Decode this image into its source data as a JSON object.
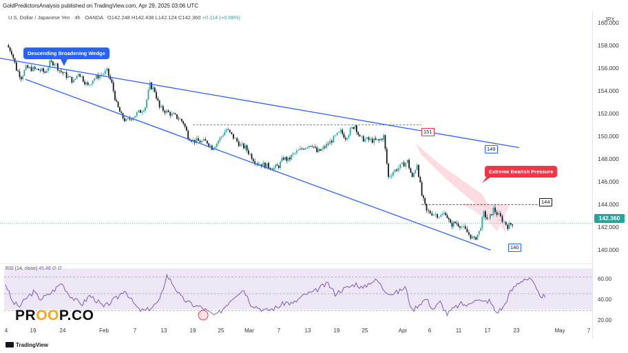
{
  "header": {
    "publish_line": "GoldPredictorsAnalysis published on TradingView.com, Apr 29, 2025 03:06 UTC",
    "symbol": "U.S. Dollar / Japanese Yen",
    "interval": "4h",
    "source": "OANDA",
    "ohlc": {
      "open": "O142.248",
      "high": "H142.438",
      "low": "L142.124",
      "close": "C142.360",
      "change": "+0.114 (+0.08%)"
    }
  },
  "colors": {
    "up": "#26a69a",
    "down": "#131722",
    "wedge_line": "#2962ff",
    "resistance_dash": "#f23645",
    "rsi_line": "#7e57c2",
    "rsi_band": "#ede7f6",
    "arrow_fill": "#fbd5dc"
  },
  "currency_label": "JPY",
  "last_price": "142.360",
  "annotations": {
    "wedge_label": "Descending Broadening Wedge",
    "pressure_label": "Extreme Bearish Pressure",
    "level_151": "151",
    "level_149": "149",
    "level_144": "144",
    "level_140": "140"
  },
  "rsi": {
    "label": "RSI (14, close)",
    "value": "45.48",
    "extra": "∅ ∅",
    "ticks": [
      "60.00",
      "40.00",
      "20.00"
    ]
  },
  "watermark": {
    "left": "PR",
    "middle": "OO",
    "right": "P.CO"
  },
  "footer": "TradingView",
  "chart_data": {
    "type": "candlestick",
    "title": "",
    "xlabel": "",
    "ylabel": "",
    "ylim": [
      139,
      161
    ],
    "y_ticks": [
      "160.000",
      "158.000",
      "156.000",
      "154.000",
      "152.000",
      "150.000",
      "148.000",
      "146.000",
      "144.000",
      "142.000",
      "140.000"
    ],
    "x_ticks": [
      "4",
      "19",
      "24",
      "Feb",
      "7",
      "13",
      "19",
      "25",
      "Mar",
      "7",
      "13",
      "19",
      "25",
      "Apr",
      "6",
      "11",
      "17",
      "23",
      "May",
      "7"
    ],
    "close_path": [
      [
        "Jan 13",
        158.0
      ],
      [
        "Jan 14",
        157.4
      ],
      [
        "Jan 15",
        155.9
      ],
      [
        "Jan 16",
        155.2
      ],
      [
        "Jan 17",
        156.0
      ],
      [
        "Jan 20",
        155.8
      ],
      [
        "Jan 21",
        155.6
      ],
      [
        "Jan 22",
        156.4
      ],
      [
        "Jan 23",
        156.5
      ],
      [
        "Jan 24",
        155.8
      ],
      [
        "Jan 27",
        154.8
      ],
      [
        "Jan 28",
        155.6
      ],
      [
        "Jan 29",
        155.0
      ],
      [
        "Jan 30",
        154.4
      ],
      [
        "Jan 31",
        155.0
      ],
      [
        "Feb 3",
        155.7
      ],
      [
        "Feb 4",
        154.6
      ],
      [
        "Feb 5",
        152.8
      ],
      [
        "Feb 6",
        151.8
      ],
      [
        "Feb 7",
        151.3
      ],
      [
        "Feb 10",
        152.2
      ],
      [
        "Feb 11",
        152.6
      ],
      [
        "Feb 12",
        154.5
      ],
      [
        "Feb 13",
        154.0
      ],
      [
        "Feb 14",
        152.5
      ],
      [
        "Feb 17",
        151.8
      ],
      [
        "Feb 18",
        151.6
      ],
      [
        "Feb 19",
        151.2
      ],
      [
        "Feb 20",
        150.0
      ],
      [
        "Feb 21",
        149.6
      ],
      [
        "Feb 24",
        149.5
      ],
      [
        "Feb 25",
        149.0
      ],
      [
        "Feb 26",
        149.4
      ],
      [
        "Feb 27",
        150.0
      ],
      [
        "Feb 28",
        150.6
      ],
      [
        "Mar 3",
        149.2
      ],
      [
        "Mar 4",
        149.0
      ],
      [
        "Mar 5",
        148.4
      ],
      [
        "Mar 6",
        147.8
      ],
      [
        "Mar 7",
        147.6
      ],
      [
        "Mar 10",
        147.2
      ],
      [
        "Mar 11",
        147.4
      ],
      [
        "Mar 12",
        148.1
      ],
      [
        "Mar 13",
        147.9
      ],
      [
        "Mar 14",
        148.4
      ],
      [
        "Mar 17",
        149.2
      ],
      [
        "Mar 18",
        149.3
      ],
      [
        "Mar 19",
        148.6
      ],
      [
        "Mar 20",
        148.8
      ],
      [
        "Mar 21",
        149.2
      ],
      [
        "Mar 24",
        150.4
      ],
      [
        "Mar 25",
        149.9
      ],
      [
        "Mar 26",
        150.5
      ],
      [
        "Mar 27",
        151.0
      ],
      [
        "Mar 28",
        149.8
      ],
      [
        "Mar 31",
        149.6
      ],
      [
        "Apr 1",
        149.6
      ],
      [
        "Apr 2",
        150.0
      ],
      [
        "Apr 3",
        146.4
      ],
      [
        "Apr 4",
        146.9
      ],
      [
        "Apr 7",
        147.8
      ],
      [
        "Apr 8",
        146.3
      ],
      [
        "Apr 9",
        147.6
      ],
      [
        "Apr 10",
        144.8
      ],
      [
        "Apr 11",
        143.4
      ],
      [
        "Apr 14",
        143.0
      ],
      [
        "Apr 15",
        143.3
      ],
      [
        "Apr 16",
        142.2
      ],
      [
        "Apr 17",
        142.4
      ],
      [
        "Apr 18",
        142.2
      ],
      [
        "Apr 21",
        140.9
      ],
      [
        "Apr 22",
        141.6
      ],
      [
        "Apr 23",
        143.2
      ],
      [
        "Apr 24",
        142.6
      ],
      [
        "Apr 25",
        143.6
      ],
      [
        "Apr 28",
        142.1
      ],
      [
        "Apr 29",
        142.36
      ]
    ],
    "overlays": {
      "wedge_upper": [
        [
          "Jan 17",
          157.0
        ],
        [
          "Apr 21",
          149.0
        ]
      ],
      "wedge_lower": [
        [
          "Jan 14",
          155.0
        ],
        [
          "Apr 23",
          140.0
        ]
      ],
      "resistance_151": 151.0,
      "resistance_144": 144.0
    },
    "rsi": {
      "ylim": [
        15,
        80
      ],
      "levels": [
        70,
        50,
        30
      ],
      "values": [
        62,
        40,
        35,
        45,
        52,
        44,
        48,
        55,
        63,
        50,
        42,
        38,
        48,
        42,
        34,
        40,
        46,
        55,
        42,
        31,
        30,
        35,
        42,
        72,
        60,
        46,
        40,
        36,
        34,
        28,
        24,
        32,
        42,
        50,
        55,
        38,
        34,
        30,
        32,
        35,
        40,
        38,
        45,
        50,
        52,
        58,
        62,
        50,
        55,
        58,
        62,
        56,
        64,
        66,
        55,
        50,
        52,
        58,
        30,
        38,
        44,
        32,
        40,
        26,
        33,
        38,
        36,
        45,
        40,
        42,
        28,
        34,
        52,
        62,
        68,
        66,
        50,
        45.48
      ]
    }
  }
}
